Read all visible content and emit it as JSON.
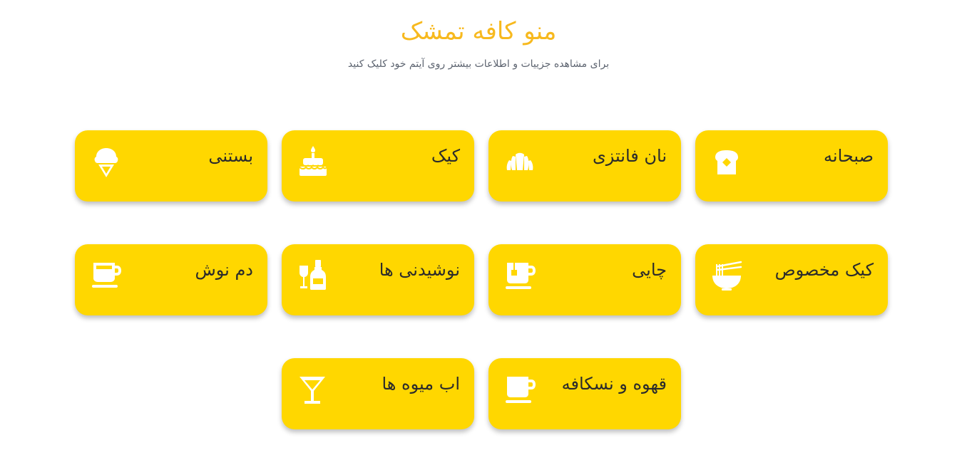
{
  "header": {
    "title": "منو کافه تمشک",
    "subtitle": "برای مشاهده جزییات و اطلاعات بیشتر روی آیتم خود کلیک کنید"
  },
  "colors": {
    "accent": "#f7b91e",
    "card": "#ffd700",
    "icon": "#ffffff"
  },
  "menu": {
    "items": [
      {
        "label": "صبحانه",
        "icon": "toast-icon"
      },
      {
        "label": "نان فانتزی",
        "icon": "croissant-icon"
      },
      {
        "label": "کیک",
        "icon": "birthday-cake-icon"
      },
      {
        "label": "بستنی",
        "icon": "ice-cream-icon"
      },
      {
        "label": "کیک مخصوص",
        "icon": "noodle-bowl-icon"
      },
      {
        "label": "چایی",
        "icon": "tea-mug-icon"
      },
      {
        "label": "نوشیدنی ها",
        "icon": "wine-bottle-icon"
      },
      {
        "label": "دم نوش",
        "icon": "coffee-cup-icon"
      },
      {
        "label": "قهوه و نسکافه",
        "icon": "coffee-mug-icon"
      },
      {
        "label": "اب میوه ها",
        "icon": "cocktail-glass-icon"
      }
    ]
  }
}
